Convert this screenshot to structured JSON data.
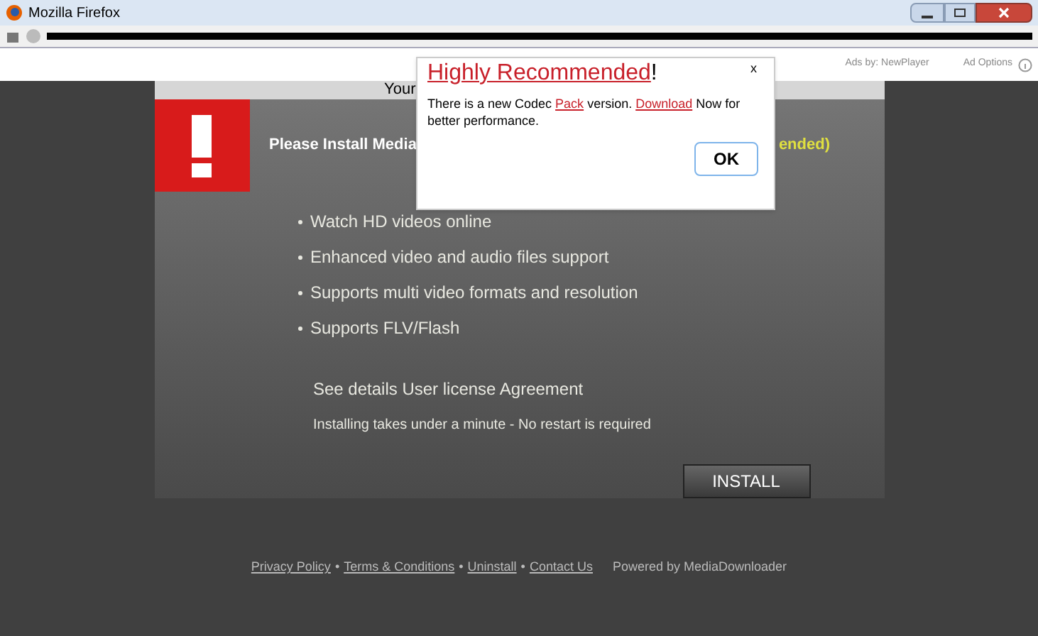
{
  "window": {
    "title": "Mozilla Firefox"
  },
  "ad_bar": {
    "label": "Ads by: NewPlayer",
    "options": "Ad Options"
  },
  "panel": {
    "header": "Your",
    "heading_left": "Please Install Media",
    "heading_right": "ended)",
    "features": [
      "Watch HD videos online",
      "Enhanced video and audio files support",
      "Supports multi video formats and resolution",
      "Supports FLV/Flash"
    ],
    "license": "See details User license Agreement",
    "note": "Installing takes under a minute - No restart is required",
    "install_button": "INSTALL"
  },
  "popup": {
    "title": "Highly Recommended",
    "title_suffix": "!",
    "close": "x",
    "text_parts": [
      {
        "kind": "text",
        "text": "There is a new Codec "
      },
      {
        "kind": "link",
        "text": "Pack"
      },
      {
        "kind": "text",
        "text": " version. "
      },
      {
        "kind": "link",
        "text": "Download"
      },
      {
        "kind": "text",
        "text": " Now for better performance."
      }
    ],
    "ok_button": "OK"
  },
  "footer": {
    "links": [
      "Privacy Policy",
      "Terms & Conditions",
      "Uninstall",
      "Contact Us"
    ],
    "separator": "•",
    "powered": "Powered by MediaDownloader"
  }
}
